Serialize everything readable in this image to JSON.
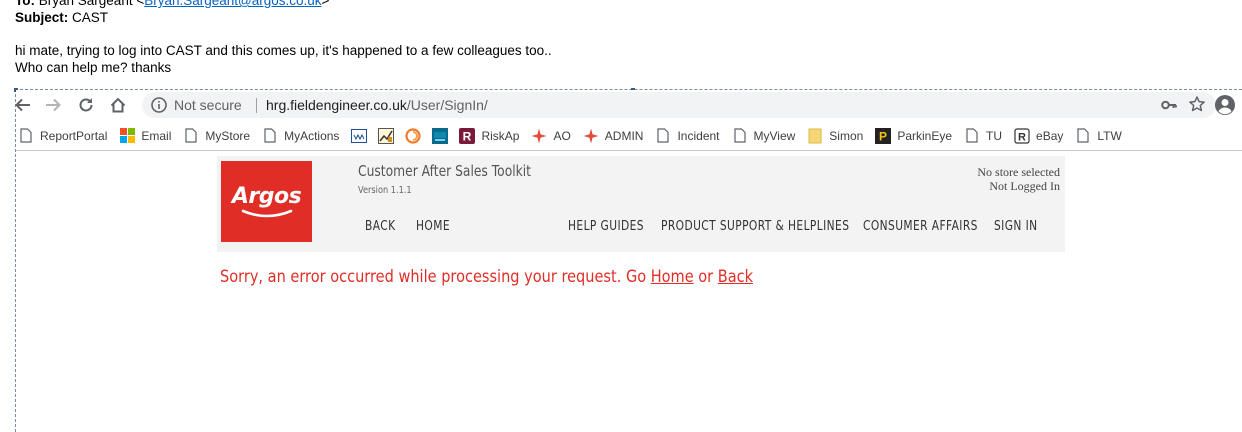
{
  "email": {
    "to_label": "To:",
    "to_name": "Bryan Sargeant <",
    "to_email": "Bryan.Sargeant@argos.co.uk",
    "to_close": ">",
    "subject_label": "Subject:",
    "subject_value": "CAST",
    "body_line1": "hi mate, trying to log into CAST and this comes up, it's happened to a few colleagues too..",
    "body_line2": "Who can help me? thanks"
  },
  "browser": {
    "security_text": "Not secure",
    "url_host": "hrg.fieldengineer.co.uk",
    "url_path": "/User/SignIn/",
    "icons": [
      "back-icon",
      "forward-icon",
      "reload-icon",
      "home-icon",
      "info-icon",
      "key-icon",
      "star-icon",
      "account-icon"
    ]
  },
  "bookmarks": [
    {
      "label": "ReportPortal",
      "icon": "page-icon"
    },
    {
      "label": "Email",
      "icon": "microsoft-icon"
    },
    {
      "label": "MyStore",
      "icon": "page-icon"
    },
    {
      "label": "MyActions",
      "icon": "page-icon"
    },
    {
      "label": "",
      "icon": "swl-icon"
    },
    {
      "label": "",
      "icon": "chart-icon"
    },
    {
      "label": "",
      "icon": "swirl-icon"
    },
    {
      "label": "",
      "icon": "ipsos-icon"
    },
    {
      "label": "RiskAp",
      "icon": "r-icon"
    },
    {
      "label": "AO",
      "icon": "sparkle-icon"
    },
    {
      "label": "ADMIN",
      "icon": "sparkle-icon"
    },
    {
      "label": "Incident",
      "icon": "page-icon"
    },
    {
      "label": "MyView",
      "icon": "page-icon"
    },
    {
      "label": "Simon",
      "icon": "folder-icon"
    },
    {
      "label": "ParkinEye",
      "icon": "parking-icon"
    },
    {
      "label": "TU",
      "icon": "page-icon"
    },
    {
      "label": "eBay",
      "icon": "r-outline-icon"
    },
    {
      "label": "LTW",
      "icon": "page-icon"
    }
  ],
  "site": {
    "logo_text": "Argos",
    "title": "Customer After Sales Toolkit",
    "version": "Version 1.1.1",
    "status_store": "No store selected",
    "status_login": "Not Logged In",
    "nav": {
      "back": "BACK",
      "home": "HOME",
      "help": "HELP GUIDES",
      "support": "PRODUCT SUPPORT & HELPLINES",
      "consumer": "CONSUMER AFFAIRS",
      "signin": "SIGN IN"
    },
    "error_text": "Sorry, an error occurred while processing your request. Go ",
    "error_home": "Home",
    "error_or": " or ",
    "error_back": "Back"
  },
  "colors": {
    "brand_red": "#e02e27",
    "link_blue": "#0563c1"
  }
}
